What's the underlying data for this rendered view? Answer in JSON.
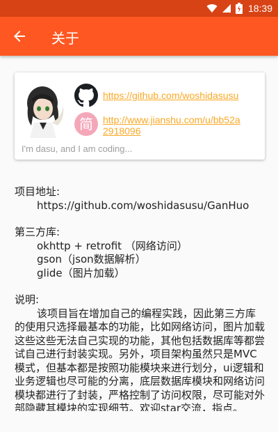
{
  "status_bar": {
    "time": "18:39",
    "icons": [
      "wifi-icon",
      "signal-icon",
      "battery-icon"
    ],
    "color": "#d84315"
  },
  "app_bar": {
    "back_icon": "arrow-back-icon",
    "title": "关于",
    "color": "#ff5722"
  },
  "card": {
    "github_icon": "github-icon",
    "github_url": "https://github.com/woshidasusu",
    "jianshu_icon_char": "简",
    "jianshu_url": "http://www.jianshu.com/u/bb52a2918096",
    "tagline": "I'm dasu, and I am coding...",
    "link_color": "#f9a825"
  },
  "content": {
    "project_label": "项目地址:",
    "project_url": "https://github.com/woshidasusu/GanHuo",
    "libs_label": "第三方库:",
    "libs": [
      "okhttp + retrofit （网络访问）",
      "gson（json数据解析）",
      "glide（图片加载）"
    ],
    "desc_label": "说明:",
    "description": "该项目旨在增加自己的编程实践，因此第三方库的使用只选择最基本的功能，比如网络访问，图片加载这些这些无法自己实现的功能，其他包括数据库等都尝试自己进行封装实现。另外，项目架构虽然只是MVC模式，但基本都是按照功能模块来进行划分，ui逻辑和业务逻辑也尽可能的分离，底层数据库模块和网络访问模块都进行了封装，严格控制了访问权限，尽可能对外部隐藏其模块的实现细节。欢迎star交流，指点。"
  }
}
